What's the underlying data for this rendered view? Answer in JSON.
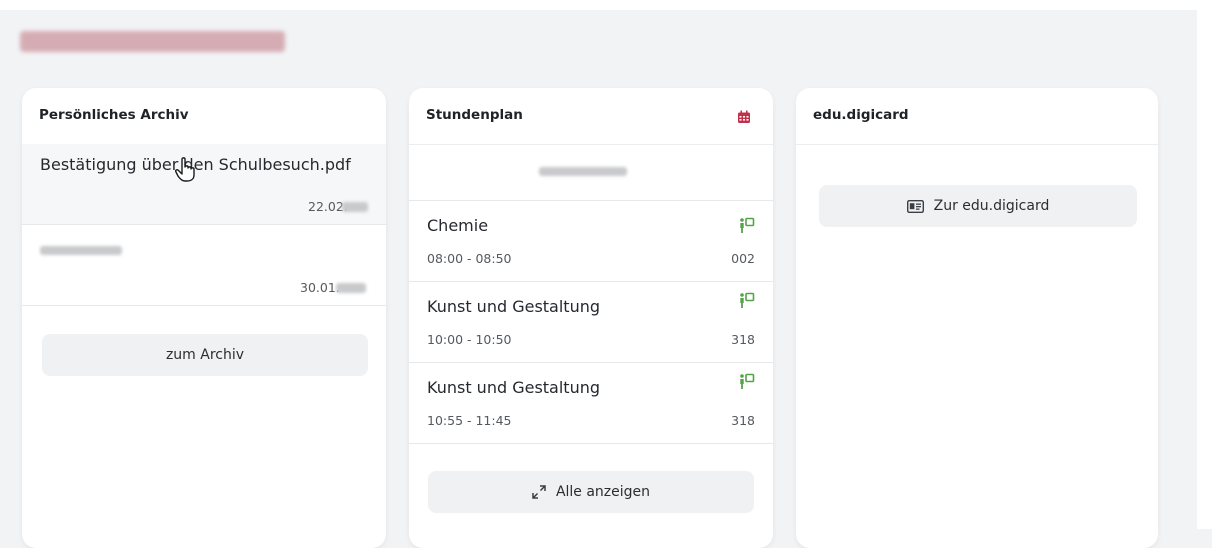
{
  "archive": {
    "title": "Persönliches Archiv",
    "items": [
      {
        "name": "Bestätigung über den Schulbesuch.pdf",
        "date": "22.02."
      },
      {
        "name": "",
        "date": "30.01."
      }
    ],
    "button_label": "zum Archiv"
  },
  "schedule": {
    "title": "Stundenplan",
    "lessons": [
      {
        "subject": "Chemie",
        "time": "08:00 - 08:50",
        "room": "002"
      },
      {
        "subject": "Kunst und Gestaltung",
        "time": "10:00 - 10:50",
        "room": "318"
      },
      {
        "subject": "Kunst und Gestaltung",
        "time": "10:55 - 11:45",
        "room": "318"
      }
    ],
    "button_label": "Alle anzeigen"
  },
  "digicard": {
    "title": "edu.digicard",
    "button_label": "Zur edu.digicard"
  },
  "colors": {
    "accent_red": "#c0314a",
    "room_green": "#55a24b"
  }
}
